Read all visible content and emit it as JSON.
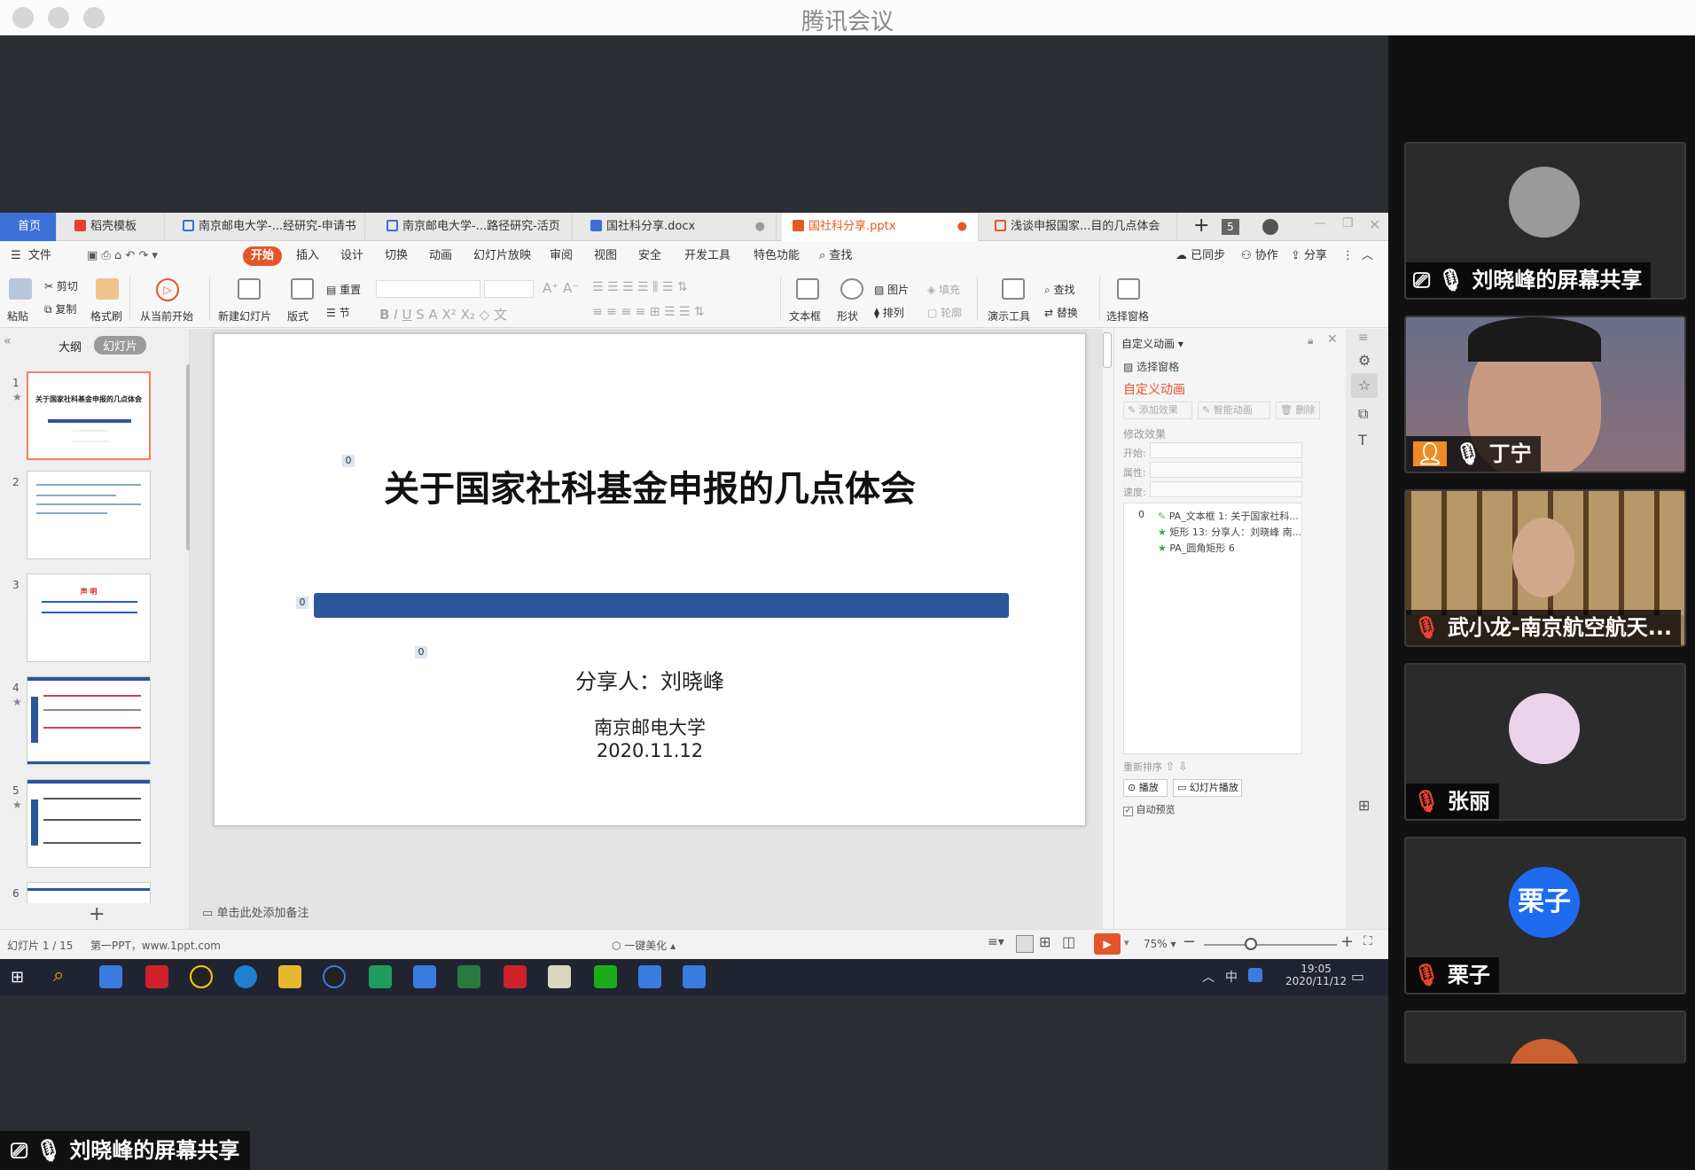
{
  "app_title": "腾讯会议",
  "wps": {
    "tabs": [
      {
        "label": "首页"
      },
      {
        "label": "稻壳模板"
      },
      {
        "label": "南京邮电大学-...经研究-申请书"
      },
      {
        "label": "南京邮电大学-...路径研究-活页"
      },
      {
        "label": "国社科分享.docx"
      },
      {
        "label": "国社科分享.pptx"
      },
      {
        "label": "浅谈申报国家...目的几点体会"
      }
    ],
    "tab_count": "5",
    "menu": [
      "文件",
      "开始",
      "插入",
      "设计",
      "切换",
      "动画",
      "幻灯片放映",
      "审阅",
      "视图",
      "安全",
      "开发工具",
      "特色功能",
      "查找"
    ],
    "menu_right": [
      "已同步",
      "协作",
      "分享"
    ],
    "ribbon": {
      "paste": "粘贴",
      "cut": "剪切",
      "copy": "复制",
      "format_painter": "格式刷",
      "from_current": "从当前开始",
      "new_slide": "新建幻灯片",
      "layout": "版式",
      "reset": "重置",
      "section": "节",
      "textbox": "文本框",
      "shape": "形状",
      "picture": "图片",
      "fill": "填充",
      "arrange": "排列",
      "outline": "轮廓",
      "present_tools": "演示工具",
      "find": "查找",
      "replace": "替换",
      "select_pane": "选择窗格"
    },
    "left_panel": {
      "tab_outline": "大纲",
      "tab_slides": "幻灯片",
      "thumbs": [
        {
          "num": "1",
          "title": "关于国家社科基金申报的几点体会"
        },
        {
          "num": "2",
          "title": ""
        },
        {
          "num": "3",
          "title": "声 明"
        },
        {
          "num": "4",
          "title": ""
        },
        {
          "num": "5",
          "title": ""
        },
        {
          "num": "6",
          "title": ""
        }
      ]
    },
    "slide": {
      "title": "关于国家社科基金申报的几点体会",
      "presenter": "分享人：刘晓峰",
      "university": "南京邮电大学",
      "date": "2020.11.12",
      "anim_tag": "0"
    },
    "notes_placeholder": "单击此处添加备注",
    "anim_pane": {
      "header": "自定义动画",
      "select_pane": "选择窗格",
      "title": "自定义动画",
      "add_effect": "添加效果",
      "smart_anim": "智能动画",
      "delete": "删除",
      "modify": "修改效果",
      "start": "开始:",
      "property": "属性:",
      "speed": "速度:",
      "list": [
        {
          "index": "0",
          "label": "PA_文本框 1: 关于国家社科..."
        },
        {
          "index": "",
          "label": "矩形 13: 分享人：刘晓峰 南..."
        },
        {
          "index": "",
          "label": "PA_圆角矩形 6"
        }
      ],
      "reorder": "重新排序",
      "play": "播放",
      "slideshow": "幻灯片播放",
      "auto_preview": "自动预览"
    },
    "status": {
      "slide_count": "幻灯片 1 / 15",
      "theme": "第一PPT，www.1ppt.com",
      "beautify": "一键美化",
      "zoom": "75%"
    },
    "taskbar": {
      "time": "19:05",
      "date": "2020/11/12",
      "ime": "中"
    }
  },
  "participants": [
    {
      "name": "刘晓峰的屏幕共享",
      "type": "share"
    },
    {
      "name": "丁宁",
      "type": "video"
    },
    {
      "name": "武小龙-南京航空航天...",
      "type": "video"
    },
    {
      "name": "张丽",
      "type": "avatar"
    },
    {
      "name": "栗子",
      "type": "avatar",
      "avatar_text": "栗子"
    }
  ],
  "bottom_badge": "刘晓峰的屏幕共享",
  "colors": {
    "accent_orange": "#e4552a",
    "slide_bar": "#2b579a",
    "home_tab": "#3c6fd8",
    "avatar_blue": "#1e6bf0"
  }
}
